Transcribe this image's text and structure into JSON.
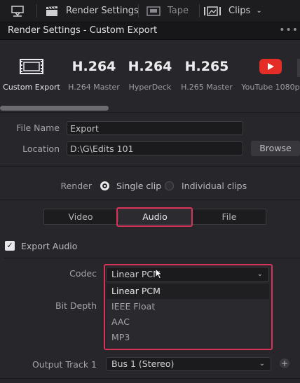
{
  "toolbar": {
    "render_settings": "Render Settings",
    "tape": "Tape",
    "clips": "Clips"
  },
  "header": {
    "title": "Render Settings - Custom Export",
    "more": "•••"
  },
  "presets": [
    {
      "big": "",
      "label": "Custom Export"
    },
    {
      "big": "H.264",
      "label": "H.264 Master"
    },
    {
      "big": "H.264",
      "label": "HyperDeck"
    },
    {
      "big": "H.265",
      "label": "H.265 Master"
    },
    {
      "big": "",
      "label": "YouTube 1080p"
    }
  ],
  "file": {
    "name_label": "File Name",
    "name_value": "Export",
    "location_label": "Location",
    "location_value": "D:\\G\\Edits 101",
    "browse": "Browse"
  },
  "render": {
    "label": "Render",
    "single": "Single clip",
    "individual": "Individual clips",
    "selected": "Single clip"
  },
  "tabs": {
    "video": "Video",
    "audio": "Audio",
    "file": "File",
    "active": "Audio"
  },
  "export_audio": {
    "label": "Export Audio",
    "checked": true
  },
  "codec": {
    "label": "Codec",
    "value": "Linear PCM",
    "options": [
      "Linear PCM",
      "IEEE Float",
      "AAC",
      "MP3"
    ]
  },
  "bit_depth": {
    "label": "Bit Depth"
  },
  "output_track": {
    "label": "Output Track 1",
    "value": "Bus 1 (Stereo)",
    "add": "+"
  },
  "colors": {
    "highlight": "#d8315a",
    "youtube": "#e52d27"
  },
  "icons": [
    "scope-icon",
    "clapper-icon",
    "tape-icon",
    "clips-icon",
    "film-icon",
    "youtube-icon",
    "chevron-down-icon",
    "check-icon",
    "plus-icon",
    "cursor-icon"
  ]
}
